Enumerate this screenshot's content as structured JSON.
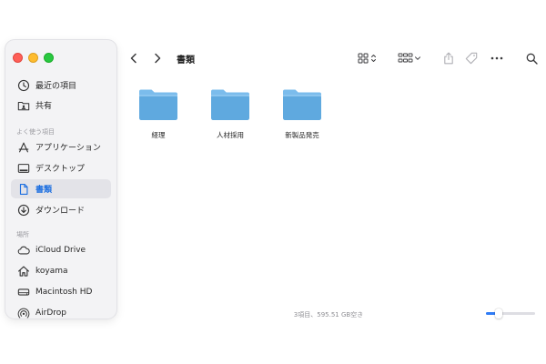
{
  "window": {
    "title": "書類"
  },
  "sidebar": {
    "favorites": [
      {
        "label": "最近の項目",
        "icon": "clock-icon",
        "selected": false
      },
      {
        "label": "共有",
        "icon": "shared-folder-icon",
        "selected": false
      }
    ],
    "section_frequent": "よく使う項目",
    "frequent": [
      {
        "label": "アプリケーション",
        "icon": "applications-icon",
        "selected": false
      },
      {
        "label": "デスクトップ",
        "icon": "desktop-icon",
        "selected": false
      },
      {
        "label": "書類",
        "icon": "document-icon",
        "selected": true
      },
      {
        "label": "ダウンロード",
        "icon": "download-icon",
        "selected": false
      }
    ],
    "section_locations": "場所",
    "locations": [
      {
        "label": "iCloud Drive",
        "icon": "cloud-icon"
      },
      {
        "label": "koyama",
        "icon": "home-icon"
      },
      {
        "label": "Macintosh HD",
        "icon": "disk-icon"
      },
      {
        "label": "AirDrop",
        "icon": "airdrop-icon"
      }
    ]
  },
  "folders": [
    {
      "label": "経理"
    },
    {
      "label": "人材採用"
    },
    {
      "label": "新製品発売"
    }
  ],
  "status": {
    "text": "3項目、595.51 GB空き",
    "zoom_level": 0.2
  },
  "colors": {
    "accent": "#1d6fe0",
    "folder": "#5fa9df",
    "folder_tab": "#7bbcec"
  }
}
